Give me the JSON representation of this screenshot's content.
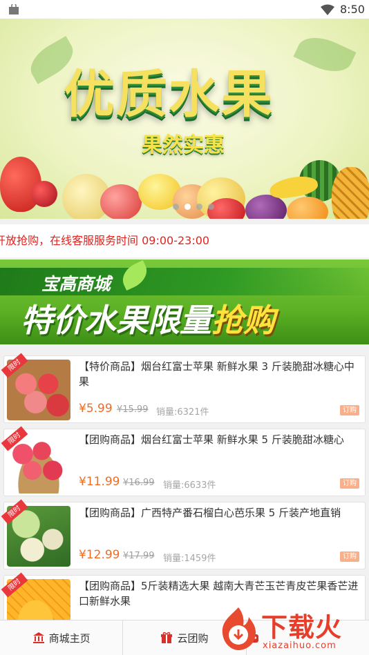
{
  "status_bar": {
    "time": "8:50"
  },
  "banner": {
    "title": "优质水果",
    "subtitle": "果然实惠",
    "page_count": 4,
    "active_page": 1
  },
  "notice": {
    "text": "开放抢购，在线客服服务时间 09:00-23:00"
  },
  "promo": {
    "brand": "宝高商城",
    "headline_main": "特价水果限量",
    "headline_accent": "抢购"
  },
  "products": [
    {
      "badge": "限时",
      "name": "【特价商品】烟台红富士苹果 新鲜水果 3 斤装脆甜冰糖心中果",
      "price": "¥5.99",
      "old_price": "¥15.99",
      "sales": "销量:6321件",
      "button": "订购"
    },
    {
      "badge": "限时",
      "name": "【团购商品】烟台红富士苹果 新鲜水果 5 斤装脆甜冰糖心",
      "price": "¥11.99",
      "old_price": "¥16.99",
      "sales": "销量:6633件",
      "button": "订购"
    },
    {
      "badge": "限时",
      "name": "【团购商品】广西特产番石榴白心芭乐果 5 斤装产地直销",
      "price": "¥12.99",
      "old_price": "¥17.99",
      "sales": "销量:1459件",
      "button": "订购"
    },
    {
      "badge": "限时",
      "name": "【团购商品】5斤装精选大果 越南大青芒玉芒青皮芒果香芒进口新鲜水果",
      "price": "",
      "old_price": "",
      "sales": "",
      "button": ""
    }
  ],
  "tabbar": {
    "items": [
      {
        "label": "商城主页",
        "icon": "bank-icon"
      },
      {
        "label": "云团购",
        "icon": "gift-icon"
      },
      {
        "label": "",
        "icon": "robot-icon"
      }
    ]
  },
  "watermark": {
    "text": "下载火",
    "url": "xiazaihuo.com"
  },
  "colors": {
    "price": "#f46b1f",
    "notice": "#e0231e",
    "promo_green": "#5cb124",
    "accent_yellow": "#ffe23b"
  }
}
